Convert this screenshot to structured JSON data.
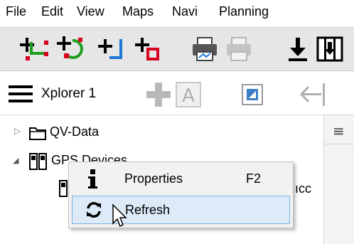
{
  "menu": [
    "File",
    "Edit",
    "View",
    "Maps",
    "Navi",
    "Planning"
  ],
  "toolbar_icons": {
    "add_waypoint": "add-waypoint-icon",
    "add_route": "add-route-icon",
    "add_track": "add-track-icon",
    "add_area": "add-area-icon",
    "print": "print-icon",
    "print_disabled": "print-disabled-icon",
    "download": "download-icon",
    "map_download": "map-download-icon"
  },
  "explorer": {
    "title": "Xplorer 1",
    "menu_icon": "hamburger-menu-icon",
    "add_icon": "plus-icon",
    "text_icon": "text-icon",
    "image_icon": "image-icon",
    "back_icon": "back-arrow-icon"
  },
  "tree": {
    "items": [
      {
        "label": "QV-Data",
        "expander": "▷",
        "icon": "folder-icon"
      },
      {
        "label": "GPS Devices",
        "expander": "◢",
        "icon": "gps-devices-icon"
      }
    ],
    "child_partial": "ıcc"
  },
  "context_menu": {
    "items": [
      {
        "label": "Properties",
        "shortcut": "F2",
        "icon": "info-icon"
      },
      {
        "label": "Refresh",
        "shortcut": "",
        "icon": "refresh-icon"
      }
    ]
  },
  "right_pane": {
    "icon": "list-icon",
    "glyph": "≡"
  },
  "colors": {
    "add_red": "#d7001e",
    "add_green": "#1e9e1e",
    "add_blue": "#1e78d2",
    "toolbar_bg": "#e6e6e6",
    "menu_hover": "#dcebf7"
  }
}
